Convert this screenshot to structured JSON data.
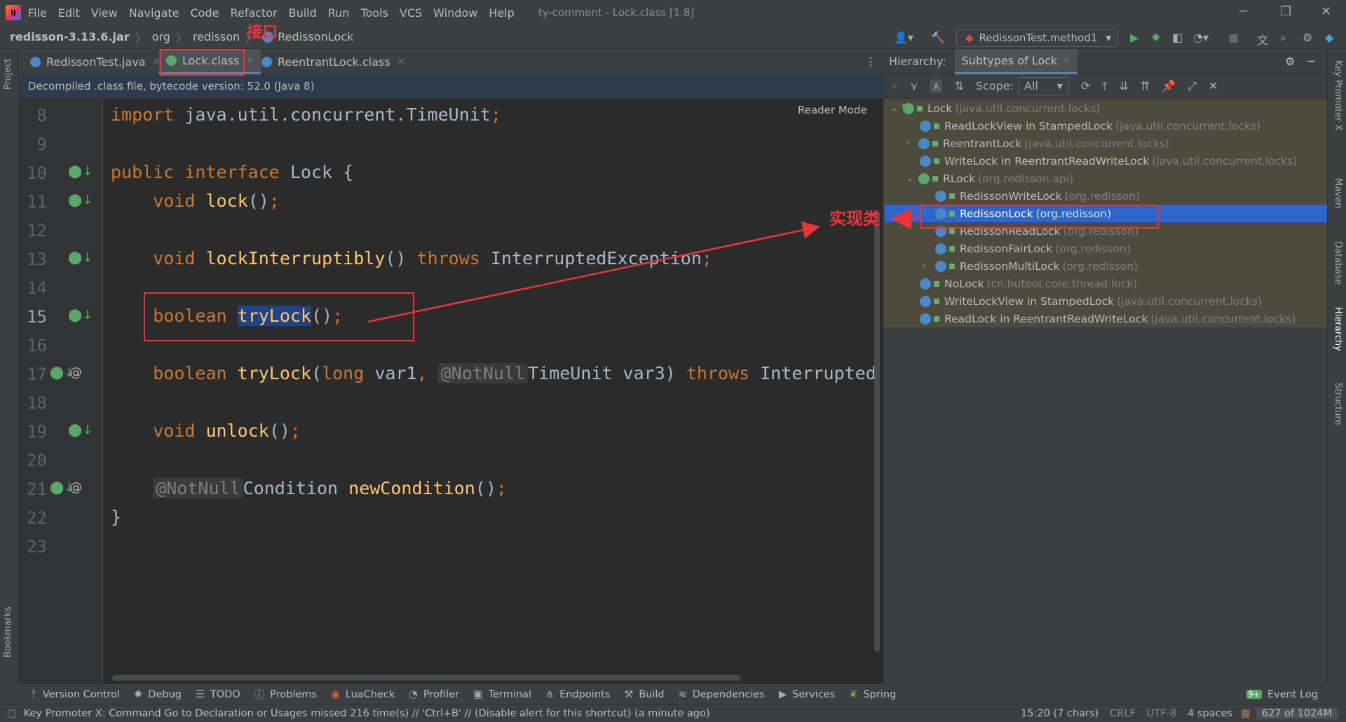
{
  "menu": {
    "items": [
      "File",
      "Edit",
      "View",
      "Navigate",
      "Code",
      "Refactor",
      "Build",
      "Run",
      "Tools",
      "VCS",
      "Window",
      "Help"
    ],
    "window_title": "ty-comment - Lock.class [1.8]"
  },
  "nav": {
    "crumbs": [
      "redisson-3.13.6.jar",
      "org",
      "redisson",
      "RedissonLock"
    ],
    "run_config": "RedissonTest.method1"
  },
  "left_strip": {
    "project": "Project",
    "bookmarks": "Bookmarks"
  },
  "tabs": [
    {
      "label": "RedissonTest.java"
    },
    {
      "label": "Lock.class"
    },
    {
      "label": "ReentrantLock.class"
    }
  ],
  "notice": "Decompiled .class file, bytecode version: 52.0 (Java 8)",
  "reader_mode": "Reader Mode",
  "editor": {
    "line_numbers": [
      "8",
      "9",
      "10",
      "11",
      "12",
      "13",
      "14",
      "15",
      "16",
      "17",
      "18",
      "19",
      "20",
      "21",
      "22",
      "23"
    ],
    "current_line": 15,
    "annotations": {
      "not_null": "@NotNull"
    }
  },
  "hierarchy": {
    "label": "Hierarchy:",
    "tab": "Subtypes of Lock",
    "scope_label": "Scope:",
    "scope_value": "All",
    "nodes": [
      {
        "name": "Lock",
        "pkg": "(java.util.concurrent.locks)",
        "kind": "interface"
      },
      {
        "name": "ReadLockView in StampedLock",
        "pkg": "(java.util.concurrent.locks)",
        "kind": "class"
      },
      {
        "name": "ReentrantLock",
        "pkg": "(java.util.concurrent.locks)",
        "kind": "class"
      },
      {
        "name": "WriteLock in ReentrantReadWriteLock",
        "pkg": "(java.util.concurrent.locks)",
        "kind": "class"
      },
      {
        "name": "RLock",
        "pkg": "(org.redisson.api)",
        "kind": "interface"
      },
      {
        "name": "RedissonWriteLock",
        "pkg": "(org.redisson)",
        "kind": "class"
      },
      {
        "name": "RedissonLock",
        "pkg": "(org.redisson)",
        "kind": "class",
        "selected": true
      },
      {
        "name": "RedissonReadLock",
        "pkg": "(org.redisson)",
        "kind": "class"
      },
      {
        "name": "RedissonFairLock",
        "pkg": "(org.redisson)",
        "kind": "class"
      },
      {
        "name": "RedissonMultiLock",
        "pkg": "(org.redisson)",
        "kind": "class"
      },
      {
        "name": "NoLock",
        "pkg": "(cn.hutool.core.thread.lock)",
        "kind": "class"
      },
      {
        "name": "WriteLockView in StampedLock",
        "pkg": "(java.util.concurrent.locks)",
        "kind": "class"
      },
      {
        "name": "ReadLock in ReentrantReadWriteLock",
        "pkg": "(java.util.concurrent.locks)",
        "kind": "class"
      }
    ]
  },
  "right_strip": [
    "Key Promoter X",
    "Maven",
    "Database",
    "Hierarchy",
    "Structure"
  ],
  "tool_windows": [
    "Version Control",
    "Debug",
    "TODO",
    "Problems",
    "LuaCheck",
    "Profiler",
    "Terminal",
    "Endpoints",
    "Build",
    "Dependencies",
    "Services",
    "Spring"
  ],
  "event_log": "Event Log",
  "event_badge": "9+",
  "status": {
    "message": "Key Promoter X: Command Go to Declaration or Usages missed 216 time(s) // 'Ctrl+B' // (Disable alert for this shortcut) (a minute ago)",
    "position": "15:20 (7 chars)",
    "line_sep": "CRLF",
    "encoding": "UTF-8",
    "indent": "4 spaces",
    "memory": "627 of 1024M"
  },
  "overlay": {
    "interface_label": "接口",
    "impl_label": "实现类"
  }
}
